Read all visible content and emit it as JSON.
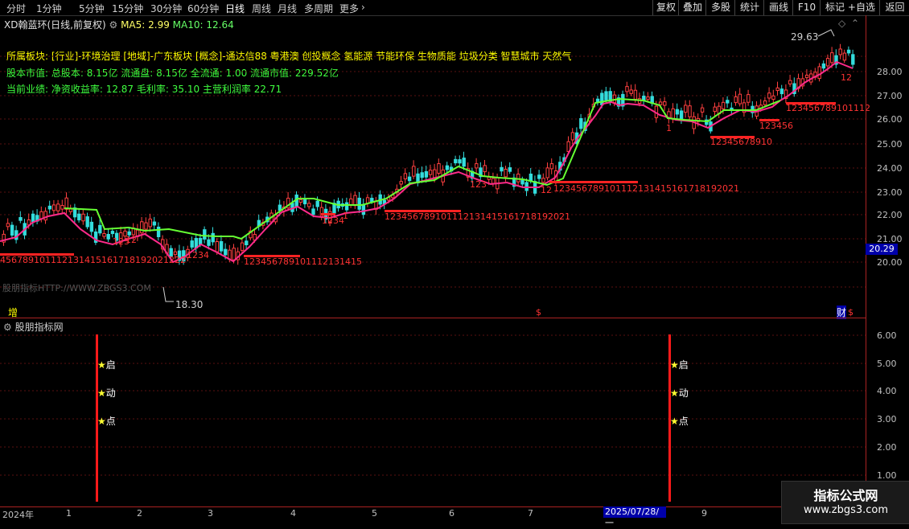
{
  "toolbar": {
    "periods": [
      "分时",
      "1分钟",
      "5分钟",
      "15分钟",
      "30分钟",
      "60分钟",
      "日线",
      "周线",
      "月线",
      "多周期",
      "更多"
    ],
    "active_period": "日线",
    "right_buttons": [
      "复权",
      "叠加",
      "多股",
      "统计",
      "画线",
      "F10",
      "+自选",
      "返回"
    ]
  },
  "title": {
    "stock": "XD翰蓝环(日线,前复权)",
    "ma5": "MA5: 2.99",
    "ma10": "MA10: 12.64"
  },
  "info": {
    "sectors": "所属板块: [行业]-环境治理 [地域]-广东板块 [概念]-通达信88 粤港澳 创投概念 氢能源 节能环保 生物质能 垃圾分类 智慧城市 天然气",
    "capital": "股本市值: 总股本: 8.15亿 流通盘: 8.15亿 全流通: 1.00 流通市值: 229.52亿",
    "performance": "当前业绩: 净资收益率: 12.87 毛利率: 35.10 主营利润率 22.71"
  },
  "price_axis": [
    "28.00",
    "27.00",
    "26.00",
    "25.00",
    "24.00",
    "23.00",
    "22.00",
    "21.00",
    "20.00"
  ],
  "current_price": "20.29",
  "high_label": "29.63",
  "low_label": "18.30",
  "watermark": "股朋指标HTTP://WWW.ZBGS3.COM",
  "markers": {
    "zeng": "增",
    "s1": "$",
    "cai": "财",
    "s2": "$"
  },
  "sub_chart": {
    "title": "股朋指标网",
    "axis": [
      "6.00",
      "5.00",
      "4.00",
      "3.00",
      "2.00",
      "1.00"
    ],
    "signals": [
      "启",
      "动",
      "点"
    ]
  },
  "counts": {
    "c1": "456789101112131415161718192021222",
    "c2": "123",
    "c3": "12",
    "c4": "1234",
    "c5": "123456789101112131415",
    "c6": "1234",
    "c7": "1",
    "c8": "123456789101112131415161718192021",
    "c9": "123",
    "c10": "12",
    "c11": "123456789101112131415161718192021",
    "c12": "1",
    "c13": "12345678910",
    "c14": "123456",
    "c15": "123456789101112",
    "c16": "12"
  },
  "time_axis": {
    "months": [
      "2024年",
      "1",
      "2",
      "3",
      "4",
      "5",
      "6",
      "7",
      "9"
    ],
    "current_date": "2025/07/28/一"
  },
  "logo": {
    "main": "指标公式网",
    "url": "www.zbgs3.com"
  }
}
